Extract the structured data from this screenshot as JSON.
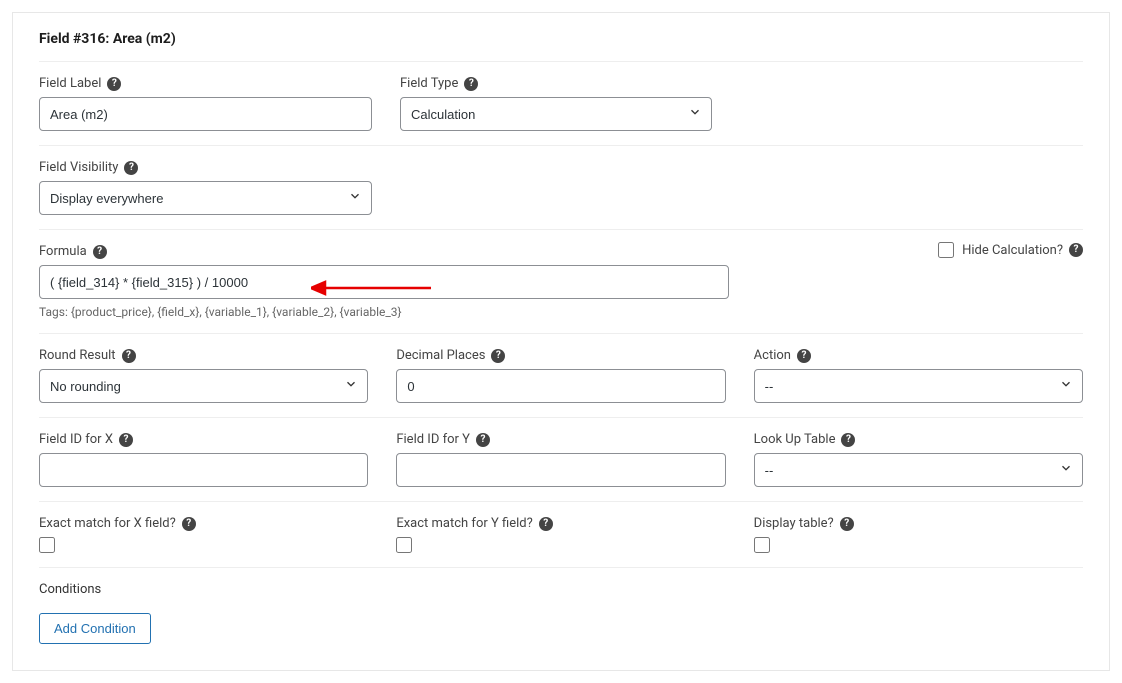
{
  "panel": {
    "title": "Field #316: Area (m2)"
  },
  "fieldLabel": {
    "label": "Field Label",
    "value": "Area (m2)"
  },
  "fieldType": {
    "label": "Field Type",
    "value": "Calculation"
  },
  "fieldVisibility": {
    "label": "Field Visibility",
    "value": "Display everywhere"
  },
  "formula": {
    "label": "Formula",
    "value": "( {field_314} * {field_315} ) / 10000",
    "hint": "Tags: {product_price}, {field_x}, {variable_1}, {variable_2}, {variable_3}"
  },
  "hideCalc": {
    "label": "Hide Calculation?"
  },
  "roundResult": {
    "label": "Round Result",
    "value": "No rounding"
  },
  "decimalPlaces": {
    "label": "Decimal Places",
    "value": "0"
  },
  "action": {
    "label": "Action",
    "value": "--"
  },
  "fieldIdX": {
    "label": "Field ID for X",
    "value": ""
  },
  "fieldIdY": {
    "label": "Field ID for Y",
    "value": ""
  },
  "lookupTable": {
    "label": "Look Up Table",
    "value": "--"
  },
  "exactX": {
    "label": "Exact match for X field?"
  },
  "exactY": {
    "label": "Exact match for Y field?"
  },
  "displayTable": {
    "label": "Display table?"
  },
  "conditions": {
    "label": "Conditions",
    "addButton": "Add Condition"
  }
}
